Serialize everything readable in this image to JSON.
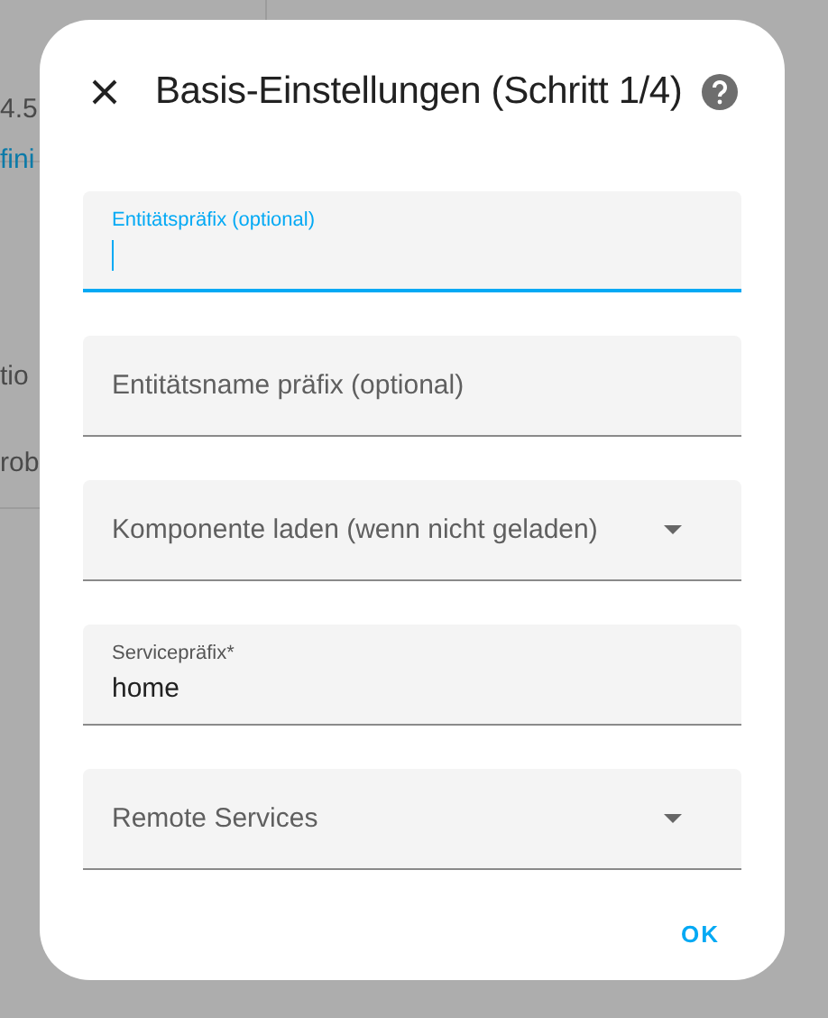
{
  "background": {
    "texts": [
      {
        "text": "4.5",
        "kind": "plain"
      },
      {
        "text": "fini",
        "kind": "link"
      },
      {
        "text": "tio",
        "kind": "plain"
      },
      {
        "text": "rob",
        "kind": "plain"
      }
    ]
  },
  "dialog": {
    "title": "Basis-Einstellungen (Schritt 1/4)",
    "fields": [
      {
        "kind": "text",
        "label": "Entitätspräfix (optional)",
        "focused": true
      },
      {
        "kind": "text",
        "label": "Entitätsname präfix (optional)",
        "focused": false
      },
      {
        "kind": "select",
        "label": "Komponente laden (wenn nicht geladen)",
        "focused": false
      },
      {
        "kind": "text",
        "label": "Servicepräfix*",
        "value": "home",
        "focused": false
      },
      {
        "kind": "select",
        "label": "Remote Services",
        "focused": false
      }
    ],
    "buttons": [
      "OK"
    ]
  }
}
